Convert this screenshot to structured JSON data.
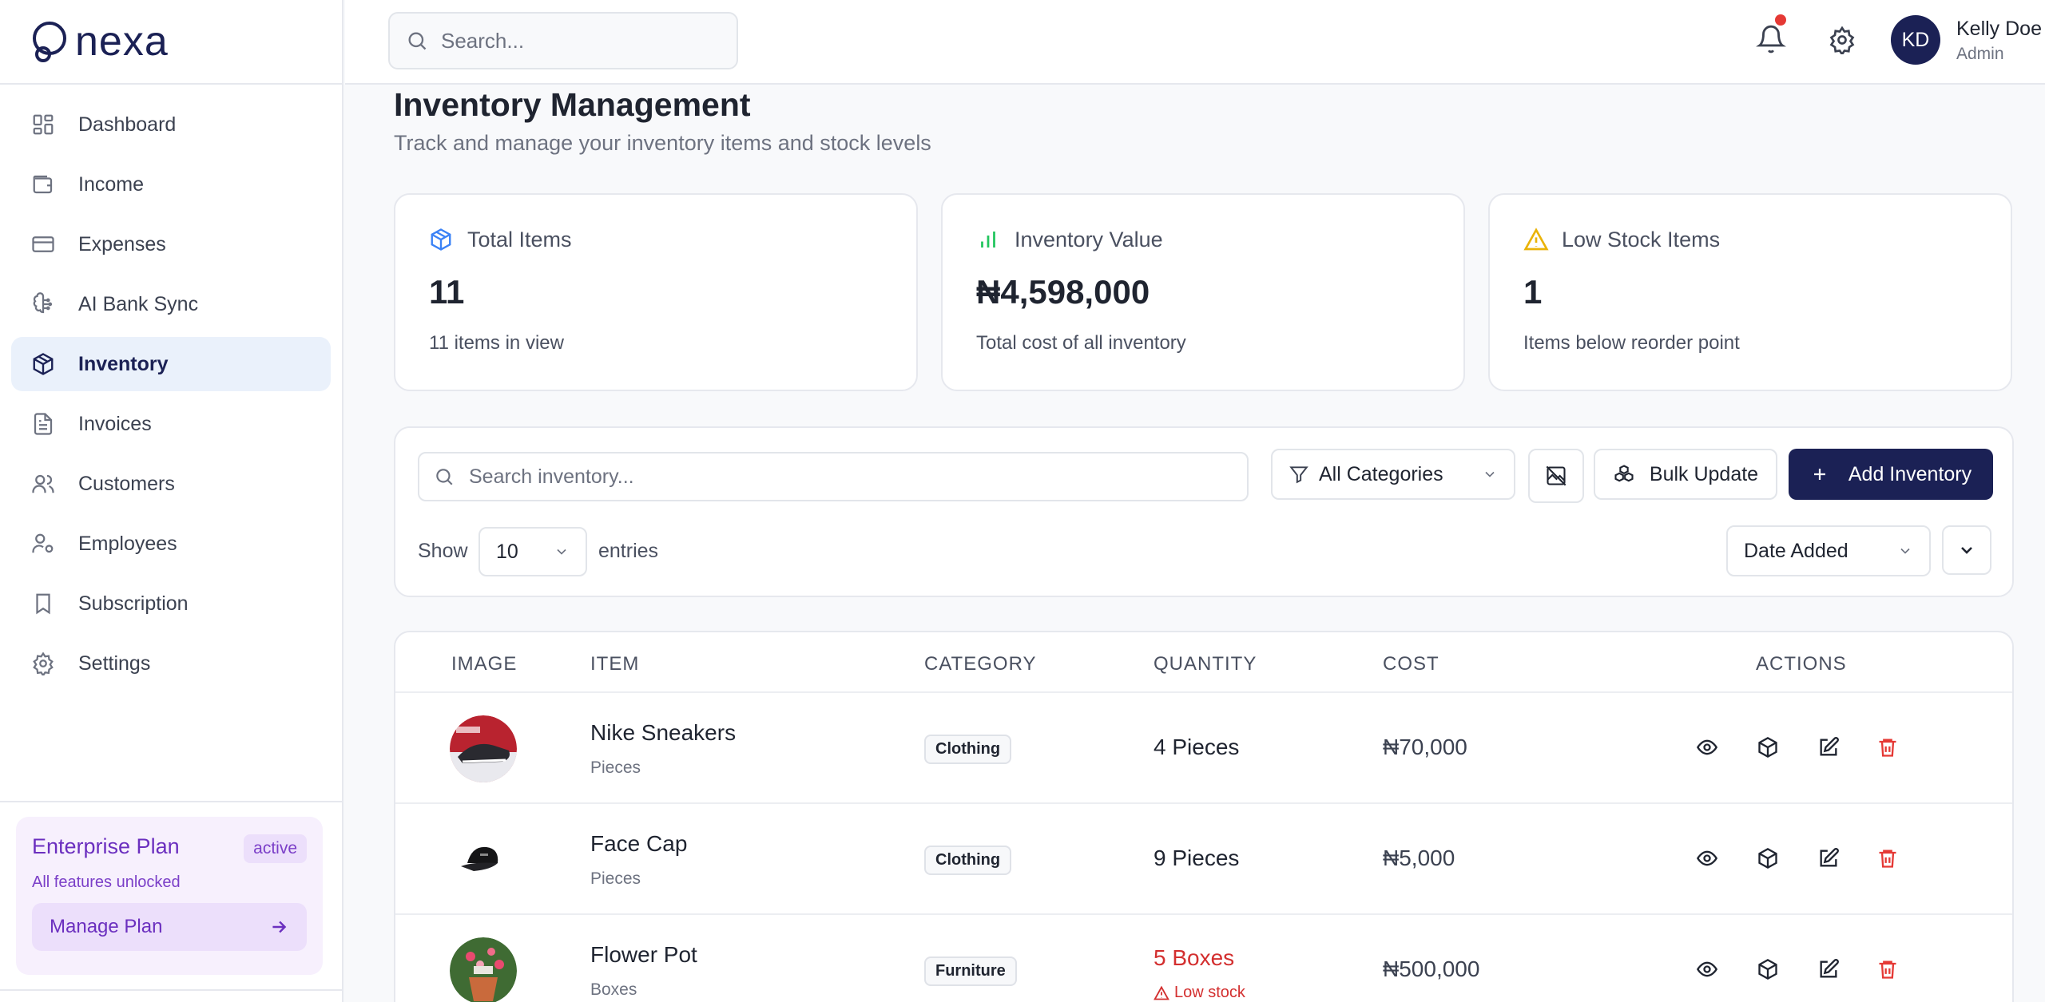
{
  "brand": {
    "name": "nexa"
  },
  "sidebar": {
    "items": [
      {
        "label": "Dashboard",
        "icon": "grid-icon"
      },
      {
        "label": "Income",
        "icon": "wallet-icon"
      },
      {
        "label": "Expenses",
        "icon": "credit-card-icon"
      },
      {
        "label": "AI Bank Sync",
        "icon": "brain-icon"
      },
      {
        "label": "Inventory",
        "icon": "package-icon",
        "active": true
      },
      {
        "label": "Invoices",
        "icon": "file-text-icon"
      },
      {
        "label": "Customers",
        "icon": "users-icon"
      },
      {
        "label": "Employees",
        "icon": "user-cog-icon"
      },
      {
        "label": "Subscription",
        "icon": "bookmark-icon"
      },
      {
        "label": "Settings",
        "icon": "gear-icon"
      }
    ],
    "plan": {
      "title": "Enterprise Plan",
      "badge": "active",
      "subtitle": "All features unlocked",
      "button": "Manage Plan"
    }
  },
  "header": {
    "search_placeholder": "Search...",
    "user": {
      "initials": "KD",
      "name": "Kelly Doe",
      "role": "Admin"
    }
  },
  "page": {
    "title": "Inventory Management",
    "subtitle": "Track and manage your inventory items and stock levels"
  },
  "stats": [
    {
      "label": "Total Items",
      "value": "11",
      "note": "11 items in view",
      "icon": "box-icon",
      "color": "#3b82f6"
    },
    {
      "label": "Inventory Value",
      "value": "₦4,598,000",
      "note": "Total cost of all inventory",
      "icon": "bar-chart-icon",
      "color": "#22c55e"
    },
    {
      "label": "Low Stock Items",
      "value": "1",
      "note": "Items below reorder point",
      "icon": "warning-icon",
      "color": "#eab308"
    }
  ],
  "toolbar": {
    "search_placeholder": "Search inventory...",
    "category": "All Categories",
    "bulk": "Bulk Update",
    "add": "Add Inventory",
    "show": "Show",
    "entries_value": "10",
    "entries": "entries",
    "sort": "Date Added"
  },
  "table": {
    "headers": [
      "IMAGE",
      "ITEM",
      "CATEGORY",
      "QUANTITY",
      "COST",
      "ACTIONS"
    ],
    "rows": [
      {
        "name": "Nike Sneakers",
        "unit": "Pieces",
        "category": "Clothing",
        "quantity": "4 Pieces",
        "cost": "₦70,000",
        "low": false
      },
      {
        "name": "Face Cap",
        "unit": "Pieces",
        "category": "Clothing",
        "quantity": "9 Pieces",
        "cost": "₦5,000",
        "low": false
      },
      {
        "name": "Flower Pot",
        "unit": "Boxes",
        "category": "Furniture",
        "quantity": "5 Boxes",
        "cost": "₦500,000",
        "low": true,
        "low_note": "Low stock"
      }
    ]
  },
  "colors": {
    "primary": "#1b2155",
    "accent_bg": "#eaf1fb",
    "danger": "#d32f2f",
    "plan": "#6b2fbf"
  }
}
